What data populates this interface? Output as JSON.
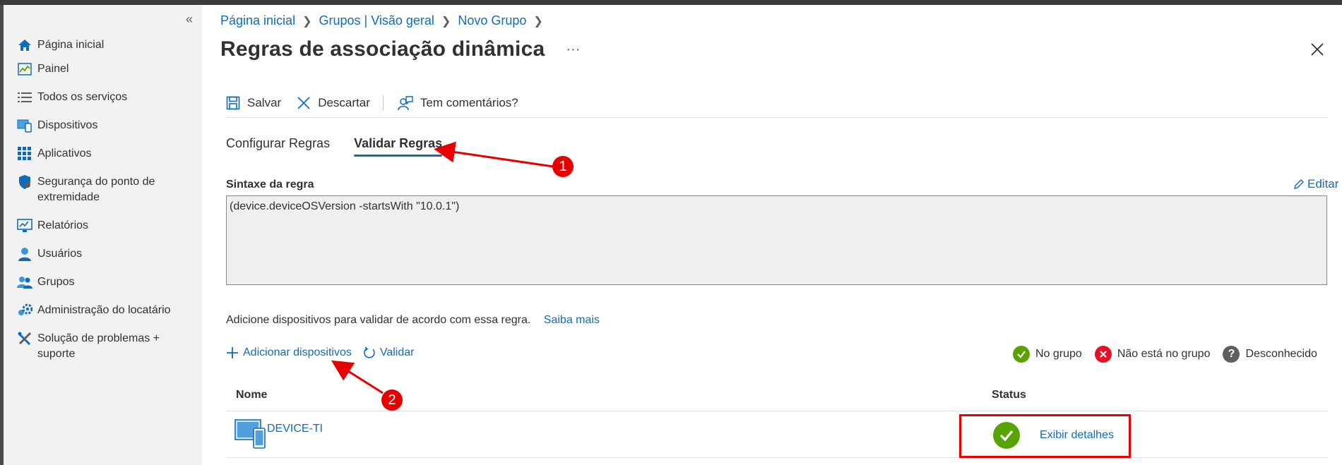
{
  "sidebar": {
    "collapse_label": "«",
    "items": [
      {
        "label": "Página inicial",
        "icon": "home-icon"
      },
      {
        "label": "Painel",
        "icon": "dashboard-icon"
      },
      {
        "label": "Todos os serviços",
        "icon": "list-icon"
      },
      {
        "label": "Dispositivos",
        "icon": "devices-icon"
      },
      {
        "label": "Aplicativos",
        "icon": "apps-icon"
      },
      {
        "label": "Segurança do ponto de extremidade",
        "icon": "shield-icon"
      },
      {
        "label": "Relatórios",
        "icon": "reports-icon"
      },
      {
        "label": "Usuários",
        "icon": "user-icon"
      },
      {
        "label": "Grupos",
        "icon": "groups-icon"
      },
      {
        "label": "Administração do locatário",
        "icon": "gear-icon"
      },
      {
        "label": "Solução de problemas + suporte",
        "icon": "tools-icon"
      }
    ]
  },
  "breadcrumb": [
    "Página inicial",
    "Grupos | Visão geral",
    "Novo Grupo"
  ],
  "page": {
    "title": "Regras de associação dinâmica",
    "more_label": "···"
  },
  "toolbar": {
    "save_label": "Salvar",
    "discard_label": "Descartar",
    "feedback_label": "Tem comentários?"
  },
  "tabs": [
    {
      "label": "Configurar Regras",
      "active": false
    },
    {
      "label": "Validar Regras",
      "active": true
    }
  ],
  "rule": {
    "label": "Sintaxe da regra",
    "edit_label": "Editar",
    "syntax": "(device.deviceOSVersion -startsWith \"10.0.1\")"
  },
  "validation": {
    "description": "Adicione dispositivos para validar de acordo com essa regra.",
    "learn_more": "Saiba mais",
    "add_devices_label": "Adicionar dispositivos",
    "validate_label": "Validar"
  },
  "legend": {
    "in_group": "No grupo",
    "not_in_group": "Não está no grupo",
    "unknown": "Desconhecido",
    "colors": {
      "in_group": "#57a300",
      "not_in_group": "#e81123",
      "unknown": "#605e5c"
    }
  },
  "table": {
    "columns": [
      "Nome",
      "Status"
    ],
    "rows": [
      {
        "name": "DEVICE-TI",
        "status": "in_group",
        "details_label": "Exibir detalhes"
      }
    ]
  },
  "annotations": [
    "1",
    "2"
  ],
  "colors": {
    "accent": "#0f6cbd",
    "annotation": "#e60000"
  }
}
